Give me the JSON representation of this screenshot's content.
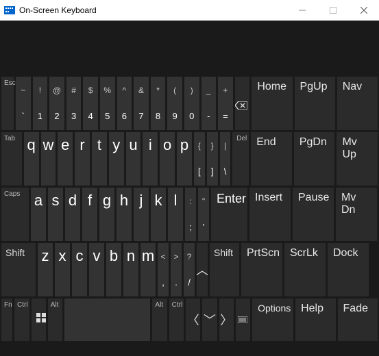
{
  "titlebar": {
    "title": "On-Screen Keyboard"
  },
  "r1": {
    "esc": "Esc",
    "keys": [
      {
        "t": "~",
        "b": "`"
      },
      {
        "t": "!",
        "b": "1"
      },
      {
        "t": "@",
        "b": "2"
      },
      {
        "t": "#",
        "b": "3"
      },
      {
        "t": "$",
        "b": "4"
      },
      {
        "t": "%",
        "b": "5"
      },
      {
        "t": "^",
        "b": "6"
      },
      {
        "t": "&",
        "b": "7"
      },
      {
        "t": "*",
        "b": "8"
      },
      {
        "t": "(",
        "b": "9"
      },
      {
        "t": ")",
        "b": "0"
      },
      {
        "t": "_",
        "b": "-"
      },
      {
        "t": "+",
        "b": "="
      }
    ],
    "nav": [
      "Home",
      "PgUp",
      "Nav"
    ]
  },
  "r2": {
    "tab": "Tab",
    "letters": [
      "q",
      "w",
      "e",
      "r",
      "t",
      "y",
      "u",
      "i",
      "o",
      "p"
    ],
    "brackets": [
      {
        "t": "{",
        "b": "["
      },
      {
        "t": "}",
        "b": "]"
      },
      {
        "t": "|",
        "b": "\\"
      }
    ],
    "del": "Del",
    "nav": [
      "End",
      "PgDn",
      "Mv Up"
    ]
  },
  "r3": {
    "caps": "Caps",
    "letters": [
      "a",
      "s",
      "d",
      "f",
      "g",
      "h",
      "j",
      "k",
      "l"
    ],
    "punct": [
      {
        "t": ":",
        "b": ";"
      },
      {
        "t": "\"",
        "b": "'"
      }
    ],
    "enter": "Enter",
    "nav": [
      "Insert",
      "Pause",
      "Mv Dn"
    ]
  },
  "r4": {
    "lshift": "Shift",
    "letters": [
      "z",
      "x",
      "c",
      "v",
      "b",
      "n",
      "m"
    ],
    "punct": [
      {
        "t": "<",
        "b": ","
      },
      {
        "t": ">",
        "b": "."
      },
      {
        "t": "?",
        "b": "/"
      },
      {
        "t": "",
        "b": ""
      }
    ],
    "rshift": "Shift",
    "nav": [
      "PrtScn",
      "ScrLk",
      "Dock"
    ]
  },
  "r5": {
    "fn": "Fn",
    "lctrl": "Ctrl",
    "lalt": "Alt",
    "ralt": "Alt",
    "rctrl": "Ctrl",
    "nav": [
      "Options",
      "Help",
      "Fade"
    ]
  }
}
